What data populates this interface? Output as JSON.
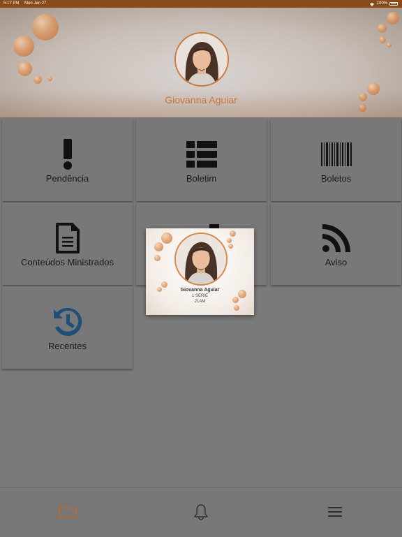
{
  "status_bar": {
    "time": "5:17 PM",
    "date": "Mon Jan 27",
    "battery": "100%"
  },
  "header": {
    "user_name": "Giovanna Aguiar"
  },
  "tiles": [
    {
      "label": "Pendência",
      "icon": "exclamation-icon"
    },
    {
      "label": "Boletim",
      "icon": "table-list-icon"
    },
    {
      "label": "Boletos",
      "icon": "barcode-icon"
    },
    {
      "label": "Conteúdos Ministrados",
      "icon": "document-icon"
    },
    {
      "label": "",
      "icon": "id-card-icon"
    },
    {
      "label": "Aviso",
      "icon": "rss-icon"
    },
    {
      "label": "Recentes",
      "icon": "history-icon"
    }
  ],
  "popup": {
    "name": "Giovanna Aguiar",
    "grade": "1 SERIE",
    "class": "21AM"
  },
  "bottom_bar": {
    "tabs": [
      "folder-icon",
      "bell-icon",
      "menu-icon"
    ],
    "active_color": "#c06a2c"
  }
}
